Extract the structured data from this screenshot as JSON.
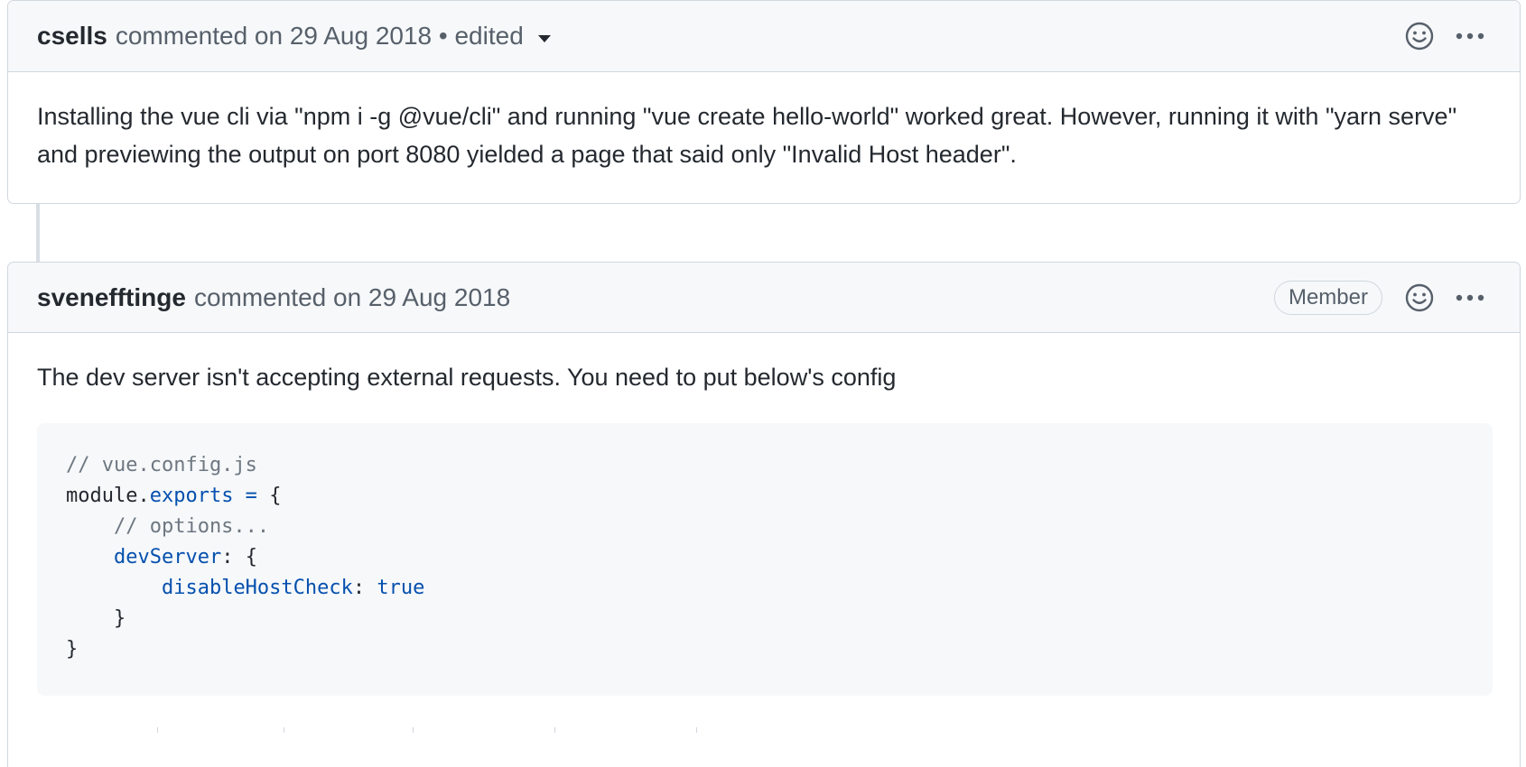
{
  "comments": [
    {
      "author": "csells",
      "meta": "commented on 29 Aug 2018 • edited",
      "body": "Installing the vue cli via \"npm i -g @vue/cli\" and running \"vue create hello-world\" worked great. However, running it with \"yarn serve\" and previewing the output on port 8080 yielded a page that said only \"Invalid Host header\"."
    },
    {
      "author": "svenefftinge",
      "meta": "commented on 29 Aug 2018",
      "badge": "Member",
      "body": "The dev server isn't accepting external requests. You need to put below's config",
      "code": {
        "line1": "// vue.config.js",
        "line2_a": "module.",
        "line2_b": "exports",
        "line2_c": " = ",
        "line2_d": "{",
        "line3": "    // options...",
        "line4_indent": "    ",
        "line4_key": "devServer",
        "line4_rest": ": {",
        "line5_indent": "        ",
        "line5_key": "disableHostCheck",
        "line5_colon": ": ",
        "line5_val": "true",
        "line6": "    }",
        "line7": "}"
      }
    }
  ],
  "icons": {
    "reaction": "smiley-icon",
    "more": "kebab-horizontal-icon",
    "edit_history": "caret-down-icon"
  },
  "colors": {
    "header_bg": "#f6f8fa",
    "border": "#d0d7de",
    "code_bg": "#f6f8fa",
    "syntax_blue": "#0550ae",
    "comment_gray": "#6e7781"
  }
}
